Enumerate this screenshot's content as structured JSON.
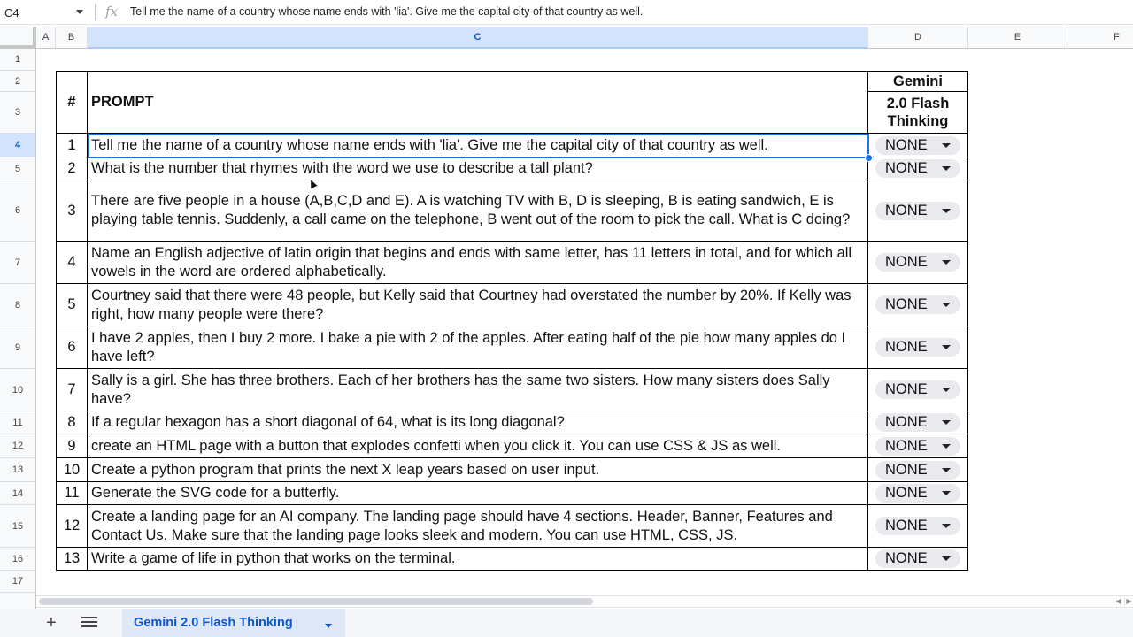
{
  "formula_bar": {
    "name_box": "C4",
    "fx_label": "fx",
    "formula": "Tell me the name of a country whose name ends with 'lia'. Give me the capital city of that country as well."
  },
  "columns": [
    "A",
    "B",
    "C",
    "D",
    "E",
    "F"
  ],
  "selected_column": "C",
  "rows": [
    "1",
    "2",
    "3",
    "4",
    "5",
    "6",
    "7",
    "8",
    "9",
    "10",
    "11",
    "12",
    "13",
    "14",
    "15",
    "16",
    "17"
  ],
  "selected_row": "4",
  "table": {
    "header": {
      "num": "#",
      "prompt": "PROMPT",
      "model_line1": "Gemini",
      "model_line2": "2.0 Flash Thinking"
    },
    "items": [
      {
        "num": "1",
        "prompt": "Tell me the name of a country whose name ends with 'lia'. Give me the capital city of that country as well.",
        "result": "NONE"
      },
      {
        "num": "2",
        "prompt": "What is the number that rhymes with the word we use to describe a tall plant?",
        "result": "NONE"
      },
      {
        "num": "3",
        "prompt": "There are five people in a house (A,B,C,D and E). A is watching TV with B, D is sleeping, B is eating sandwich, E is playing table tennis. Suddenly, a call came on the telephone, B went out of the room to pick the call. What is C doing?",
        "result": "NONE"
      },
      {
        "num": "4",
        "prompt": "Name an English adjective of latin origin that begins and ends with same letter, has 11 letters in total, and for which all vowels in the word are ordered alphabetically.",
        "result": "NONE"
      },
      {
        "num": "5",
        "prompt": "Courtney said that there were 48 people, but Kelly said that Courtney had overstated the number by 20%. If Kelly was right, how many people were there?",
        "result": "NONE"
      },
      {
        "num": "6",
        "prompt": "I have 2 apples, then I buy 2 more. I bake a pie with 2 of the apples. After eating half of the pie how many apples do I have left?",
        "result": "NONE"
      },
      {
        "num": "7",
        "prompt": "Sally is a girl. She has three brothers. Each of her brothers has the same two sisters. How many sisters does Sally have?",
        "result": "NONE"
      },
      {
        "num": "8",
        "prompt": "If a regular hexagon has a short diagonal of 64, what is its long diagonal?",
        "result": "NONE"
      },
      {
        "num": "9",
        "prompt": "create an HTML page with a button that explodes confetti when you click it. You can use CSS & JS as well.",
        "result": "NONE"
      },
      {
        "num": "10",
        "prompt": "Create a python program that prints the next X leap years based on user input.",
        "result": "NONE"
      },
      {
        "num": "11",
        "prompt": "Generate the SVG code for a butterfly.",
        "result": "NONE"
      },
      {
        "num": "12",
        "prompt": "Create a landing page for an AI company. The landing page should have 4 sections. Header, Banner, Features and Contact Us. Make sure that the landing page looks sleek and modern. You can use HTML, CSS, JS.",
        "result": "NONE"
      },
      {
        "num": "13",
        "prompt": "Write a game of life in python that works on the terminal.",
        "result": "NONE"
      }
    ]
  },
  "sheet_tabs": {
    "add_label": "+",
    "active_tab": "Gemini 2.0 Flash Thinking"
  },
  "colors": {
    "selection": "#1a73e8",
    "selected_header_bg": "#d3e3fd",
    "chip_bg": "#e8eaed",
    "tab_text": "#0b57d0"
  }
}
